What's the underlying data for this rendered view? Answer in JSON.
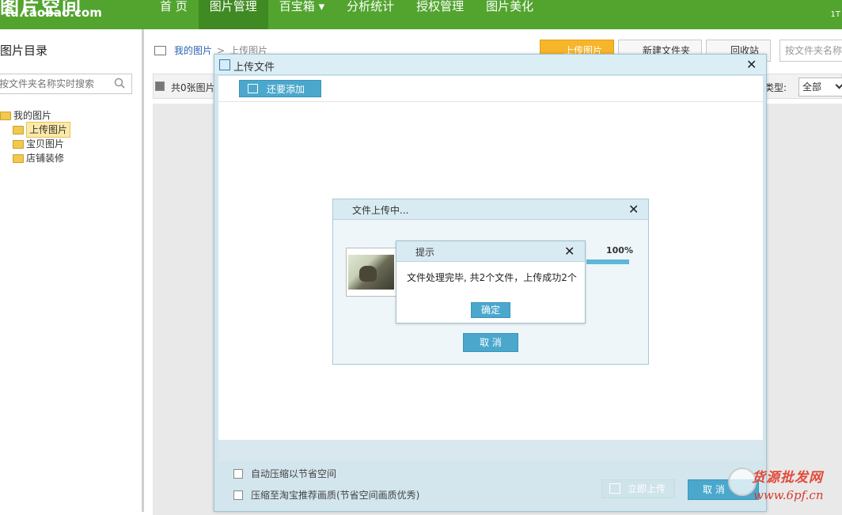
{
  "header": {
    "logo_main": "图片空间",
    "logo_sub": "tu.taobao.com",
    "nav": [
      "首 页",
      "图片管理",
      "百宝箱 ▾",
      "分析统计",
      "授权管理",
      "图片美化"
    ],
    "right_text": "1T"
  },
  "sidebar": {
    "title": "图片目录",
    "search_placeholder": "按文件夹名称实时搜索",
    "tree": {
      "root": "我的图片",
      "children": [
        "上传图片",
        "宝贝图片",
        "店铺装修"
      ]
    }
  },
  "main": {
    "breadcrumb": {
      "root": "我的图片",
      "sep": ">",
      "current": "上传图片"
    },
    "toolbar": {
      "upload": "上传图片",
      "new_folder": "新建文件夹",
      "recycle": "回收站"
    },
    "search_placeholder": "按文件夹名称",
    "count_text": "共0张图片",
    "type_label": "类型:",
    "type_value": "全部"
  },
  "upload_dialog": {
    "title": "上传文件",
    "add_more": "还要添加",
    "option_compress": "自动压缩以节省空间",
    "option_taobao": "压缩至淘宝推荐画质(节省空间画质优秀)",
    "upload_now": "立即上传",
    "cancel": "取 消"
  },
  "progress_dialog": {
    "title": "文件上传中...",
    "percent_text": "100%",
    "progress": 1.0,
    "cancel": "取 消"
  },
  "alert": {
    "title": "提示",
    "message": "文件处理完毕, 共2个文件，上传成功2个",
    "ok": "确定"
  },
  "watermark": {
    "line1": "货源批发网",
    "line2": "www.6pf.cn"
  }
}
